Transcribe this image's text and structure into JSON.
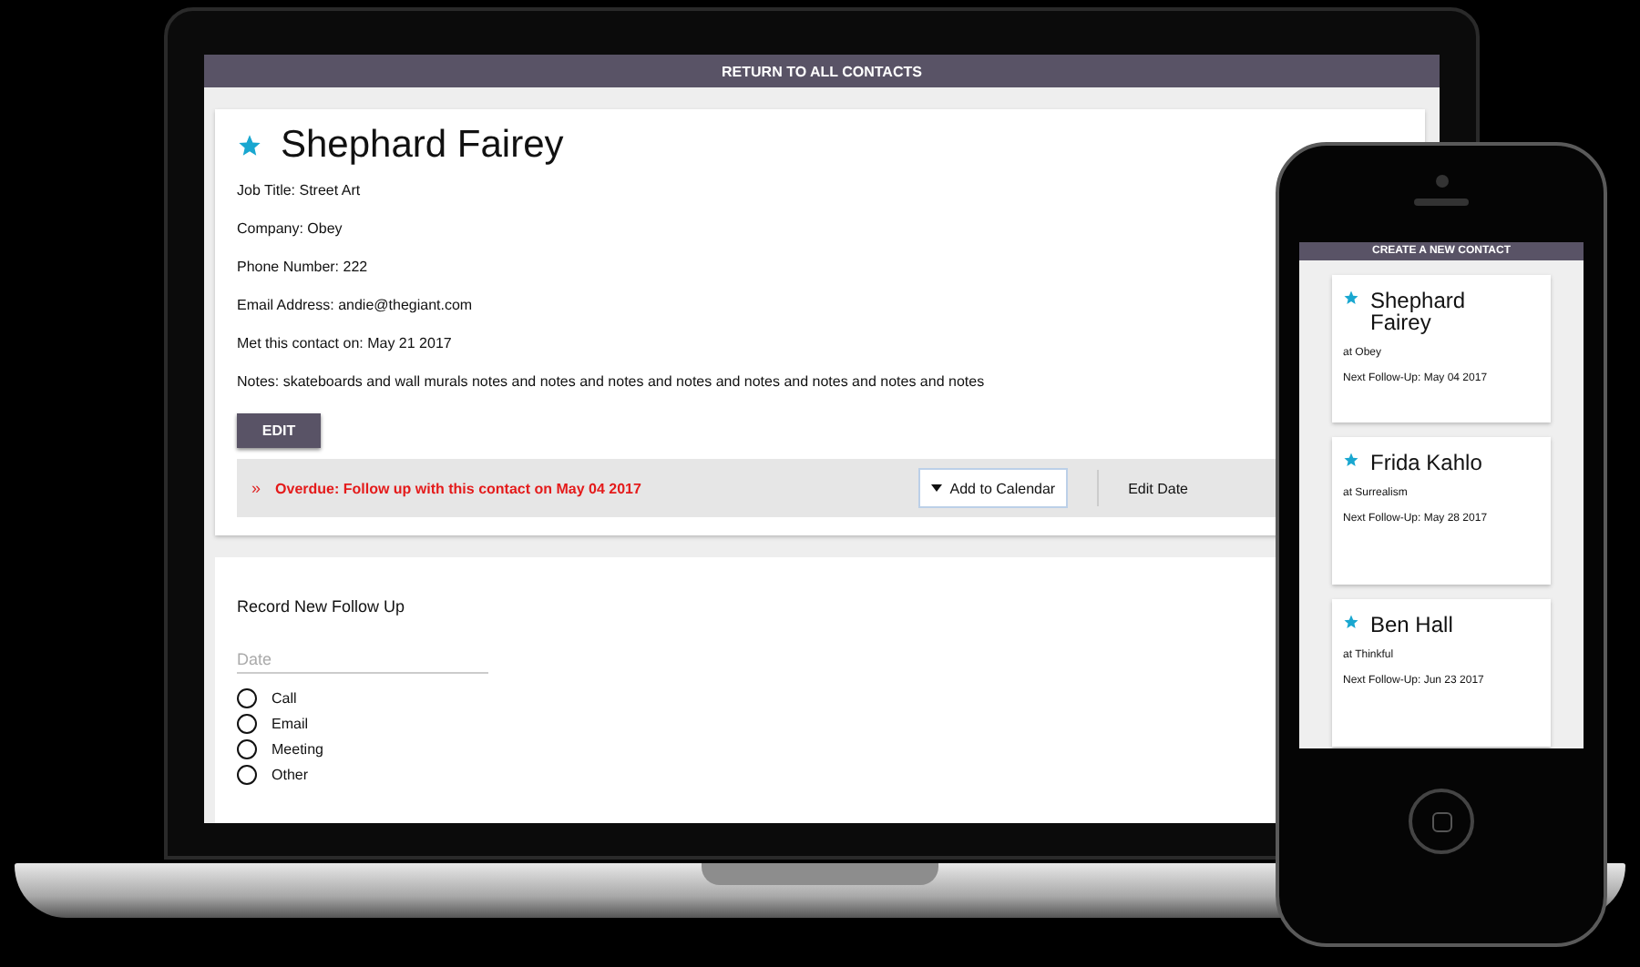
{
  "laptop": {
    "top_bar": "RETURN TO ALL CONTACTS",
    "contact": {
      "name": "Shephard Fairey",
      "fields": [
        "Job Title: Street Art",
        "Company: Obey",
        "Phone Number: 222",
        "Email Address: andie@thegiant.com",
        "Met this contact on: May 21 2017",
        "Notes: skateboards and wall murals notes and notes and notes and notes and notes and notes and notes and notes"
      ],
      "edit_button": "EDIT",
      "overdue": {
        "marker": "»",
        "text": "Overdue: Follow up with this contact on May 04 2017",
        "calendar_button": "Add to Calendar",
        "edit_date": "Edit Date"
      }
    },
    "follow_up": {
      "title": "Record New Follow Up",
      "date": {
        "placeholder": "Date"
      },
      "options": [
        {
          "label": "Call",
          "selected": false
        },
        {
          "label": "Email",
          "selected": false
        },
        {
          "label": "Meeting",
          "selected": false
        },
        {
          "label": "Other",
          "selected": false
        }
      ]
    }
  },
  "phone": {
    "top_bar": "CREATE A NEW CONTACT",
    "contacts": [
      {
        "name": "Shephard Fairey",
        "company": "at Obey",
        "next": "Next Follow-Up: May 04 2017"
      },
      {
        "name": "Frida Kahlo",
        "company": "at Surrealism",
        "next": "Next Follow-Up: May 28 2017"
      },
      {
        "name": "Ben Hall",
        "company": "at Thinkful",
        "next": "Next Follow-Up: Jun 23 2017"
      }
    ]
  }
}
